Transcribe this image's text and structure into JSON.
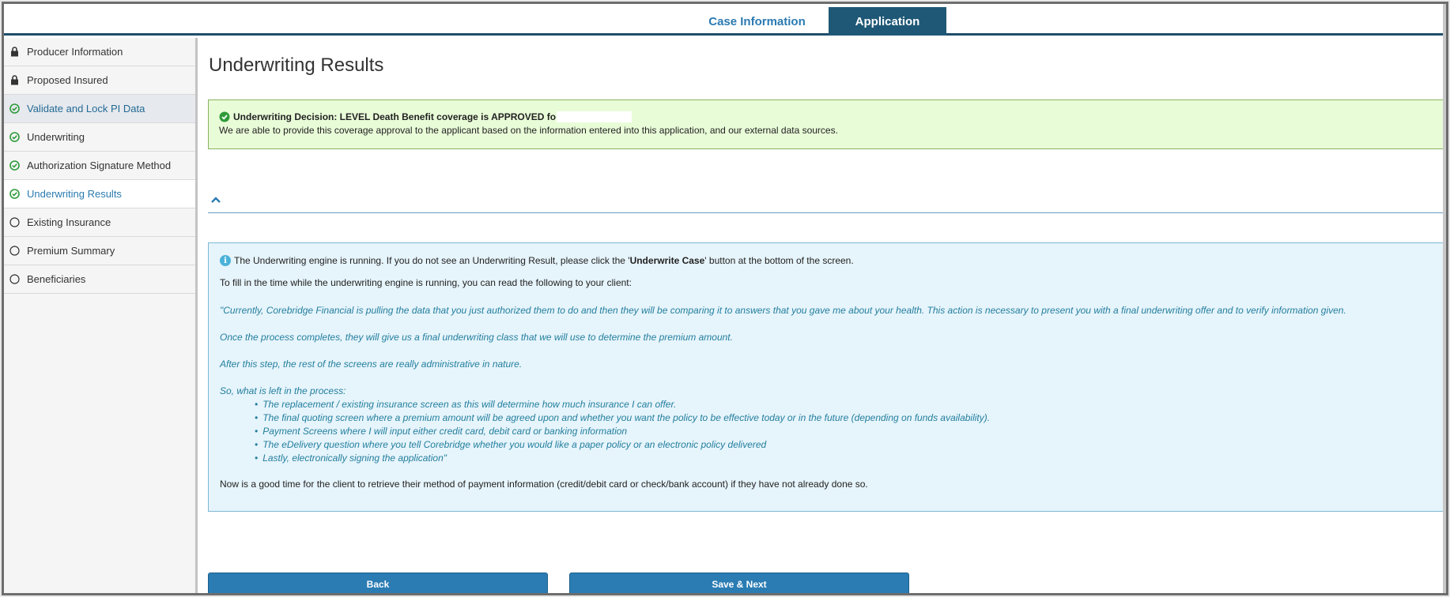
{
  "tabs": {
    "case_info": "Case Information",
    "application": "Application"
  },
  "sidebar": {
    "items": [
      {
        "label": "Producer Information",
        "icon": "lock-icon"
      },
      {
        "label": "Proposed Insured",
        "icon": "lock-icon"
      },
      {
        "label": "Validate and Lock PI Data",
        "icon": "check-circle-icon"
      },
      {
        "label": "Underwriting",
        "icon": "check-circle-icon"
      },
      {
        "label": "Authorization Signature Method",
        "icon": "check-circle-icon"
      },
      {
        "label": "Underwriting Results",
        "icon": "check-circle-icon"
      },
      {
        "label": "Existing Insurance",
        "icon": "empty-circle-icon"
      },
      {
        "label": "Premium Summary",
        "icon": "empty-circle-icon"
      },
      {
        "label": "Beneficiaries",
        "icon": "empty-circle-icon"
      }
    ]
  },
  "main": {
    "title": "Underwriting Results",
    "decision": {
      "headline": "Underwriting Decision: LEVEL Death Benefit coverage is APPROVED fo",
      "detail": "We are able to provide this coverage approval to the applicant based on the information entered into this application, and our external data sources."
    },
    "info": {
      "line1_pre": "The Underwriting engine is running. If you do not see an Underwriting Result, please click the '",
      "line1_bold": "Underwrite Case",
      "line1_post": "' button at the bottom of the screen.",
      "line2": "To fill in the time while the underwriting engine is running, you can read the following to your client:",
      "quote1": "\"Currently, Corebridge Financial is pulling the data that you just authorized them to do and then they will be comparing it to answers that you gave me about your health. This action is necessary to present you with a final underwriting offer and to verify information given.",
      "quote2": "Once the process completes, they will give us a final underwriting class that we will use to determine the premium amount.",
      "quote3": "After this step, the rest of the screens are really administrative in nature.",
      "quote4": "So, what is left in the process:",
      "bullets": [
        "The replacement / existing insurance screen as this will determine how much insurance I can offer.",
        "The final quoting screen where a premium amount will be agreed upon and whether you want the policy to be effective today or in the future (depending on funds availability).",
        "Payment Screens where I will input either credit card, debit card or banking information",
        "The eDelivery question where you tell Corebridge whether you would like a paper policy or an electronic policy delivered",
        "Lastly, electronically signing the application\""
      ],
      "final": "Now is a good time for the client to retrieve their method of payment information (credit/debit card or check/bank account) if they have not already done so."
    },
    "buttons": {
      "back": "Back",
      "save_next": "Save & Next"
    }
  },
  "colors": {
    "active_tab": "#1f5876",
    "accent_blue": "#2a7cb3",
    "success_bg": "#e9fcd8",
    "success_icon": "#2e9a3a",
    "info_bg": "#e6f4fb"
  }
}
